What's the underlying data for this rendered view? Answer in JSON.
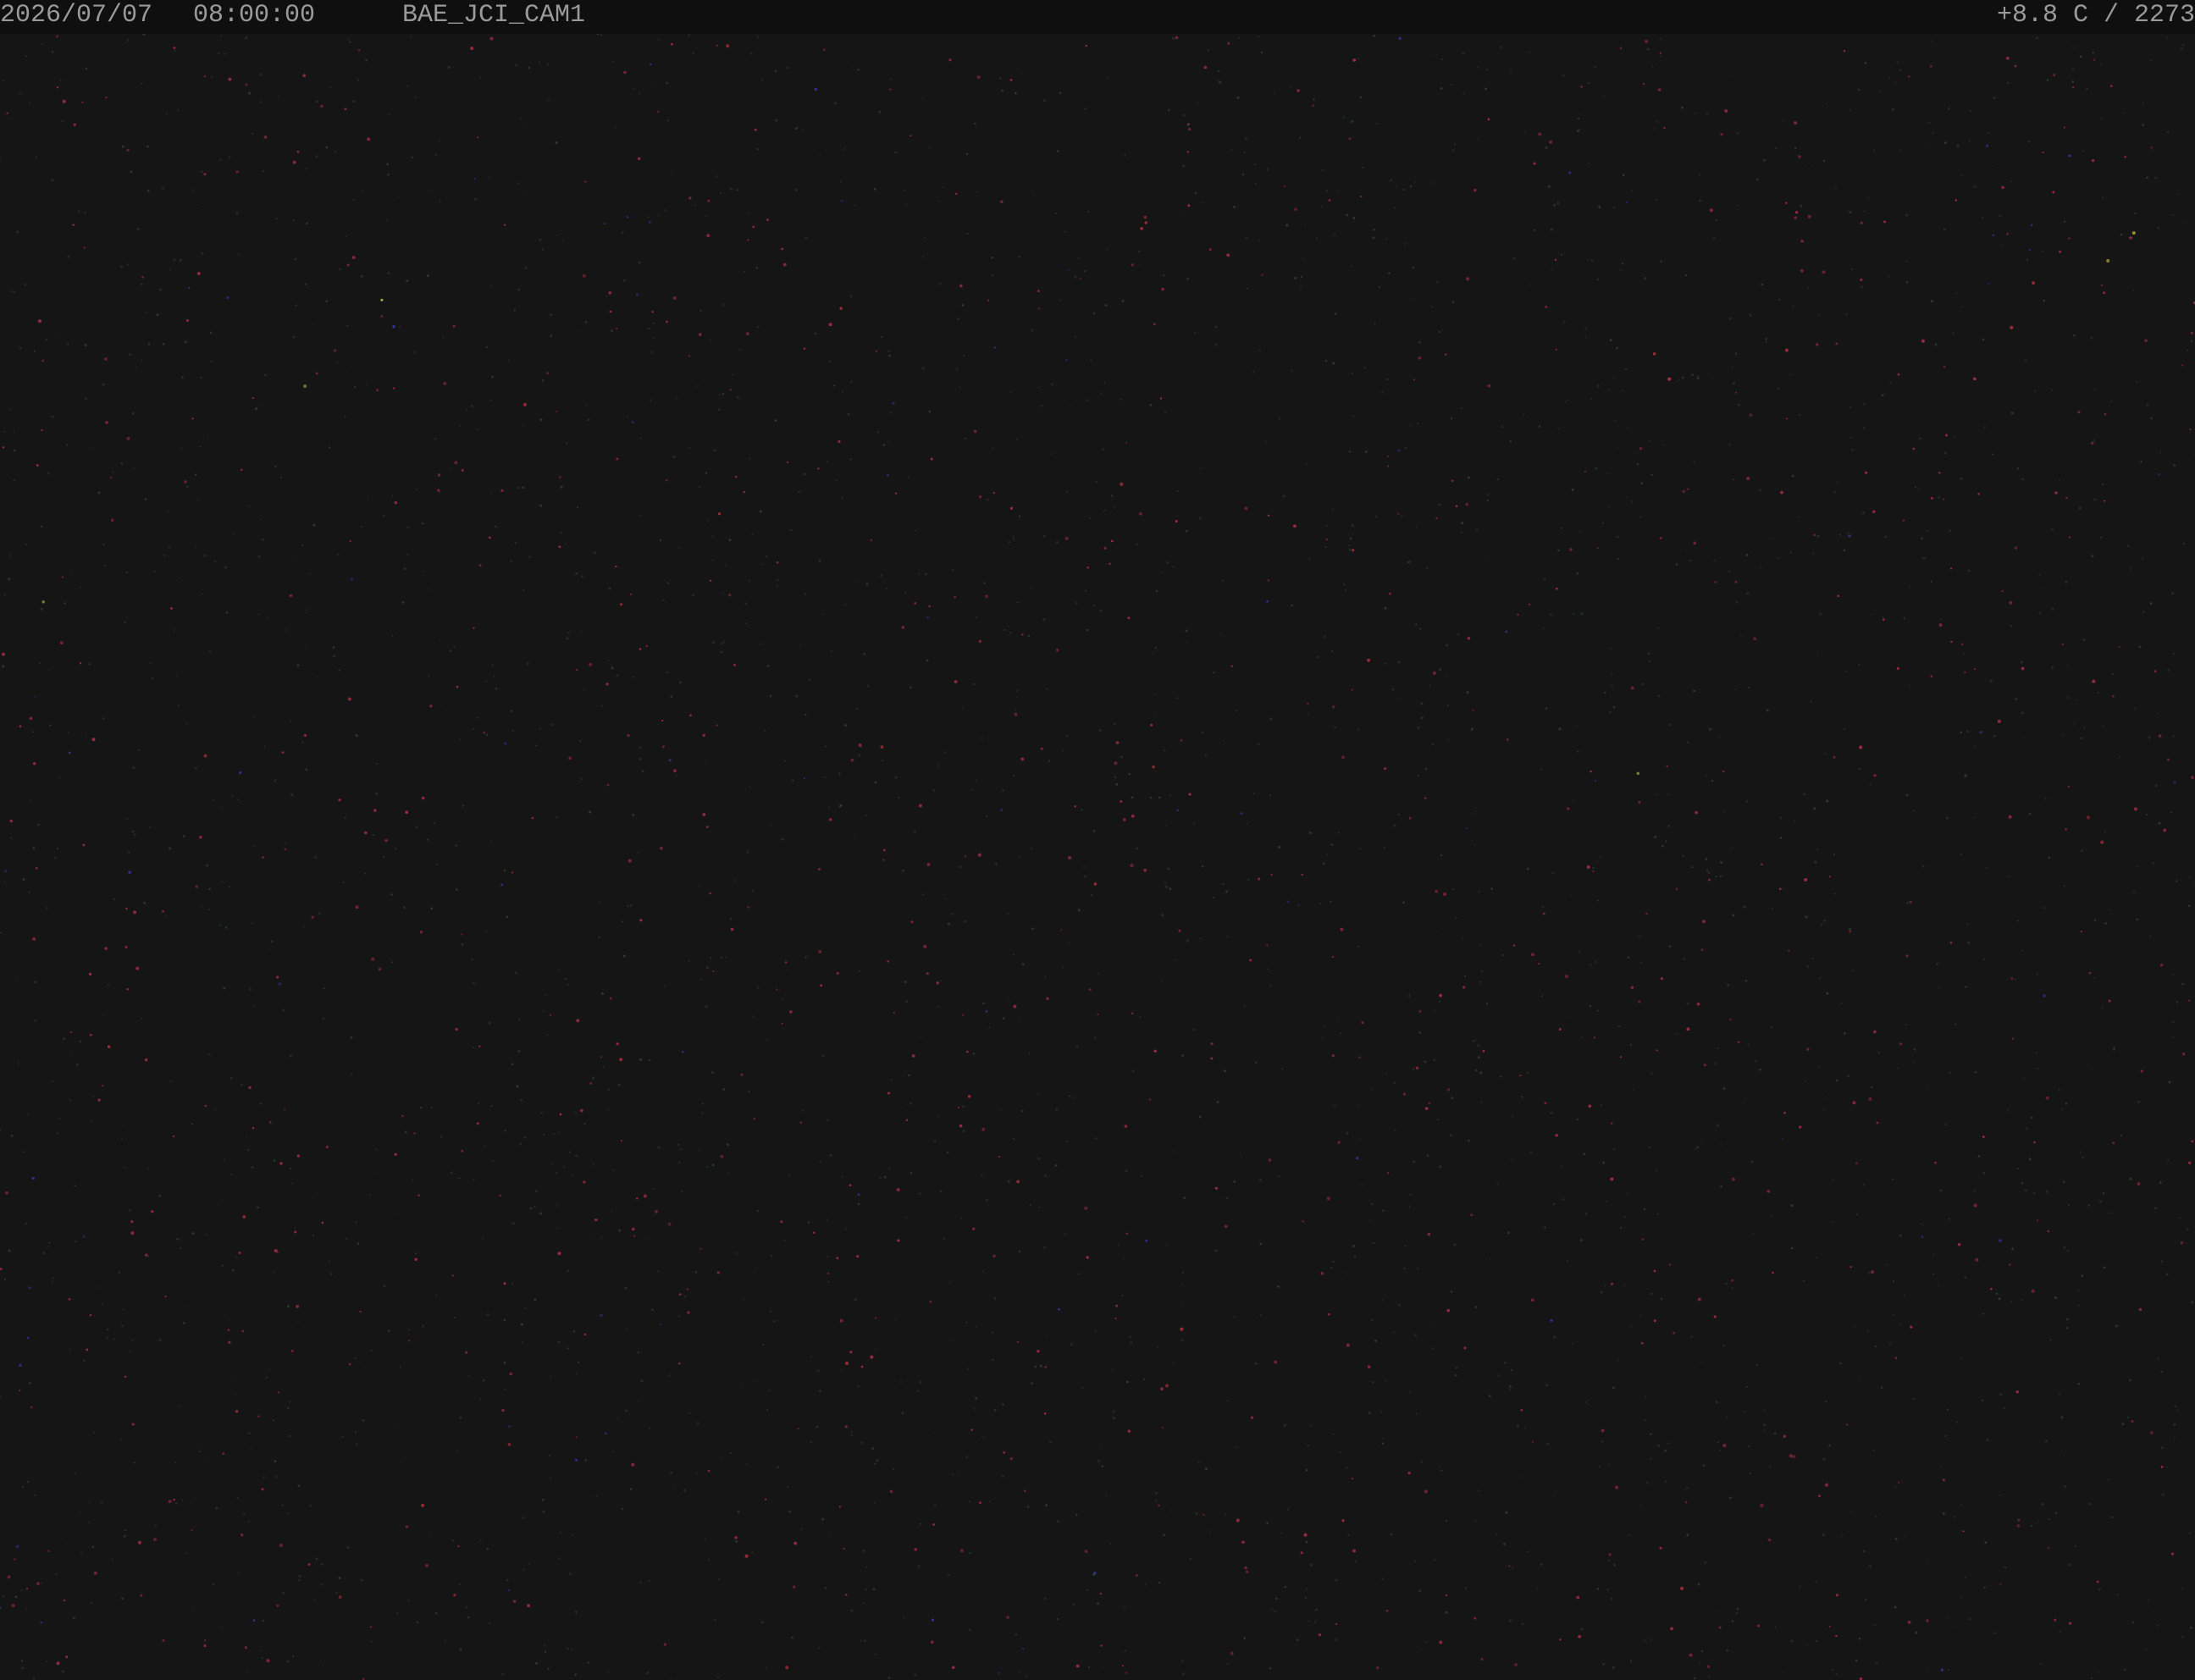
{
  "osd": {
    "date": "2026/07/07",
    "time": "08:00:00",
    "camera_name": "BAE_JCI_CAM1",
    "temperature_reading": "+8.8 C / 2273"
  },
  "colors": {
    "background": "#151515",
    "osd_bar": "#0f0f0f",
    "osd_text": "#9a9a9a",
    "noise_red": "#c0304a",
    "noise_green": "#3c5a3c",
    "noise_blue": "#3a3ab8",
    "noise_yellow": "#c8c040"
  },
  "icons": {
    "sensor_noise": "sensor-noise-pattern"
  }
}
